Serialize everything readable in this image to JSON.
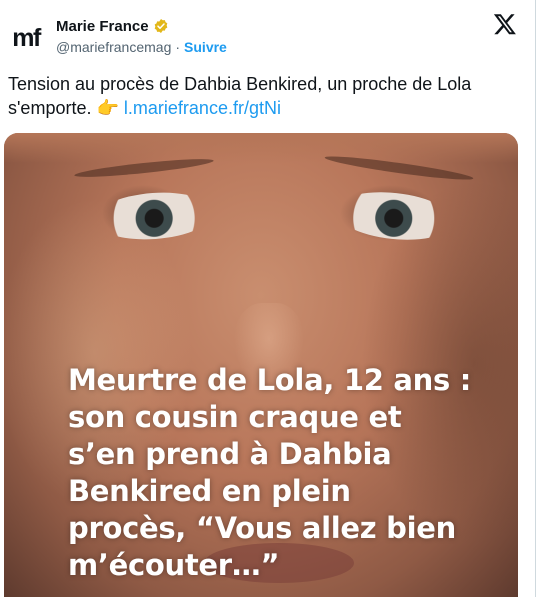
{
  "account": {
    "avatar_text": "mf",
    "name": "Marie France",
    "handle": "@mariefrancemag",
    "separator": "·",
    "follow_label": "Suivre"
  },
  "tweet": {
    "text_line1": "Tension au procès de Dahbia Benkired, un proche de Lola",
    "text_line2": "s'emporte. ",
    "emoji": "👉",
    "link_text": "l.mariefrance.fr/gtNi"
  },
  "media": {
    "caption": "Meurtre de Lola, 12 ans :\nson cousin craque et\ns’en prend à Dahbia\nBenkired en plein\nprocès, “Vous allez bien\nm’écouter…”"
  },
  "colors": {
    "link": "#1d9bf0",
    "verified_badge": "#e2b719",
    "text": "#0f1419",
    "secondary_text": "#536471"
  },
  "icons": {
    "verified": "verified-badge-icon",
    "platform": "x-logo-icon"
  }
}
